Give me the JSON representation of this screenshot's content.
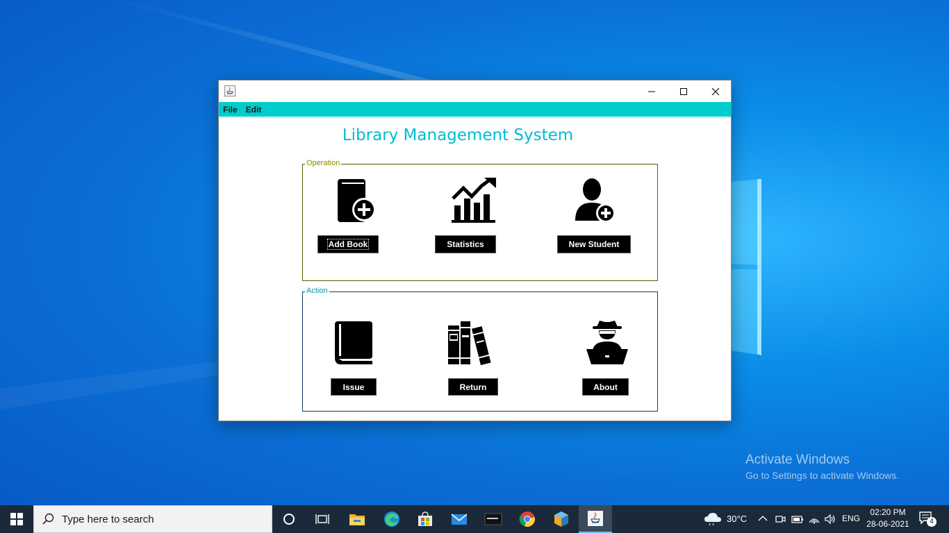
{
  "window": {
    "menu": [
      "File",
      "Edit"
    ],
    "app_title": "Library Management System",
    "operation": {
      "legend": "Operation",
      "buttons": [
        {
          "label": "Add Book",
          "icon": "add-book-icon"
        },
        {
          "label": "Statistics",
          "icon": "statistics-chart-icon"
        },
        {
          "label": "New Student",
          "icon": "add-user-icon"
        }
      ]
    },
    "action": {
      "legend": "Action",
      "buttons": [
        {
          "label": "Issue",
          "icon": "closed-book-icon"
        },
        {
          "label": "Return",
          "icon": "books-stack-icon"
        },
        {
          "label": "About",
          "icon": "hacker-laptop-icon"
        }
      ]
    },
    "colors": {
      "menubar": "#00cccc",
      "title": "#00bcd4",
      "operation_border": "#5a5a00",
      "action_border": "#0a3a6a"
    }
  },
  "desktop": {
    "watermark_line1": "Activate Windows",
    "watermark_line2": "Go to Settings to activate Windows."
  },
  "taskbar": {
    "search_placeholder": "Type here to search",
    "weather": "30°C",
    "language": "ENG",
    "time": "02:20 PM",
    "date": "28-06-2021",
    "notifications": "4",
    "apps": [
      "cortana-icon",
      "task-view-icon",
      "file-explorer-icon",
      "edge-icon",
      "store-icon",
      "mail-icon",
      "mysql-icon",
      "chrome-icon",
      "netbeans-icon",
      "java-icon"
    ]
  }
}
